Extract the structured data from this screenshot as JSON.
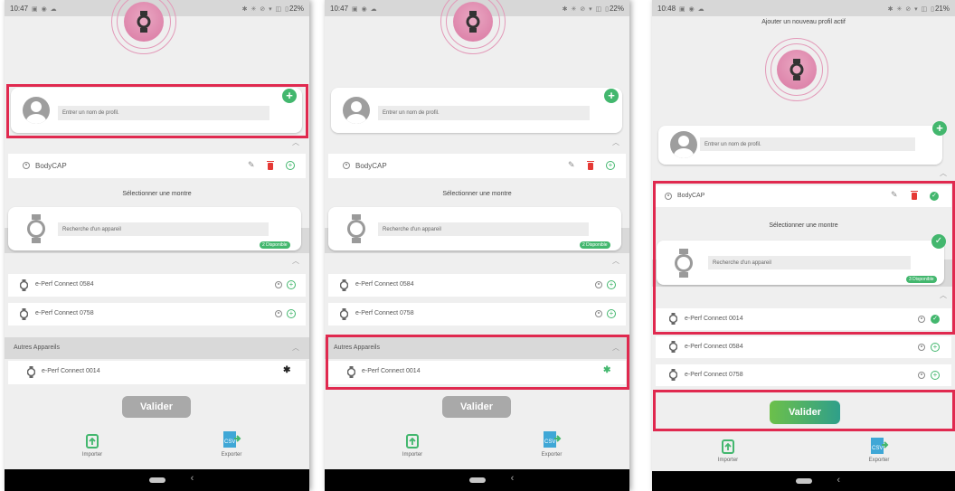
{
  "screens": [
    {
      "status_time": "10:47",
      "status_battery": "22%",
      "profile_placeholder": "Entrer un nom de profil.",
      "profile_name": "BodyCAP",
      "select_watch_title": "Sélectionner une montre",
      "search_placeholder": "Recherche d'un appareil",
      "available_badge": "2 Disponible",
      "devices": [
        "e-Perf Connect 0584",
        "e-Perf Connect 0758"
      ],
      "other_devices_title": "Autres Appareils",
      "other_device": "e-Perf Connect 0014",
      "validate_label": "Valider",
      "import_label": "Importer",
      "export_label": "Exporter"
    },
    {
      "status_time": "10:47",
      "status_battery": "22%",
      "profile_placeholder": "Entrer un nom de profil.",
      "profile_name": "BodyCAP",
      "select_watch_title": "Sélectionner une montre",
      "search_placeholder": "Recherche d'un appareil",
      "available_badge": "2 Disponible",
      "devices": [
        "e-Perf Connect 0584",
        "e-Perf Connect 0758"
      ],
      "other_devices_title": "Autres Appareils",
      "other_device": "e-Perf Connect 0014",
      "validate_label": "Valider",
      "import_label": "Importer",
      "export_label": "Exporter"
    },
    {
      "status_time": "10:48",
      "status_battery": "21%",
      "top_title": "Ajouter un nouveau profil actif",
      "profile_placeholder": "Entrer un nom de profil.",
      "profile_name": "BodyCAP",
      "select_watch_title": "Sélectionner une montre",
      "search_placeholder": "Recherche d'un appareil",
      "available_badge": "3 Disponible",
      "devices": [
        "e-Perf Connect 0014",
        "e-Perf Connect 0584",
        "e-Perf Connect 0758"
      ],
      "validate_label": "Valider",
      "import_label": "Importer",
      "export_label": "Exporter"
    }
  ],
  "icons": {
    "watch": "watch-icon",
    "avatar": "avatar-icon",
    "add": "plus-icon",
    "edit": "pencil-icon",
    "delete": "trash-icon",
    "bluetooth": "bluetooth-icon",
    "import": "import-icon",
    "export": "csv-export-icon"
  },
  "colors": {
    "accent_green": "#43b76e",
    "highlight_red": "#e0294f",
    "delete_red": "#e53935",
    "ring_pink": "#d978a2",
    "validate_grey": "#a9a9a9"
  }
}
